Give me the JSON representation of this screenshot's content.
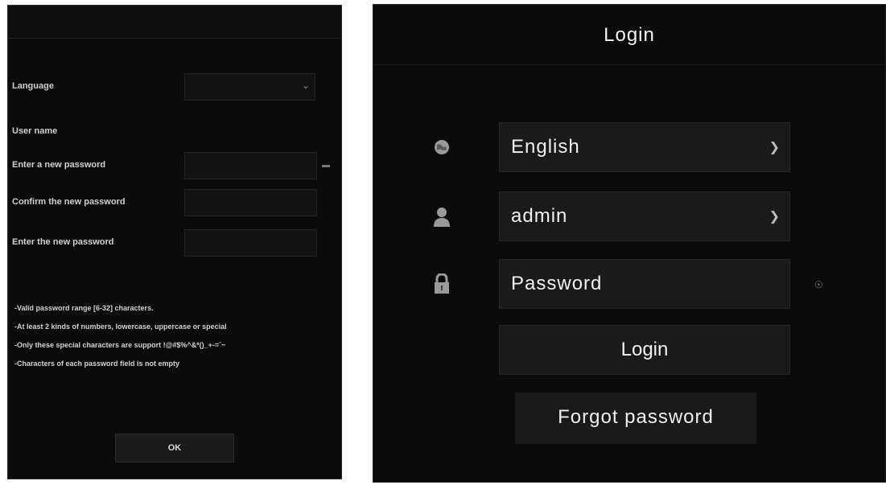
{
  "left_dialog": {
    "labels": {
      "language": "Language",
      "username": "User name",
      "new_password": "Enter a new password",
      "confirm_password": "Confirm the new password",
      "enter_password_again": "Enter the new password"
    },
    "rules": [
      "-Valid password range [6-32] characters.",
      "-At least 2 kinds of numbers, lowercase, uppercase or special",
      "-Only these special characters are support !@#$%^&*()_+-=`~",
      "-Characters of each password field is not empty"
    ],
    "ok_label": "OK"
  },
  "login_dialog": {
    "title": "Login",
    "language_value": "English",
    "username_value": "admin",
    "password_placeholder": "Password",
    "login_label": "Login",
    "forgot_label": "Forgot password"
  },
  "icons": {
    "globe": "globe-icon",
    "user": "user-icon",
    "lock": "lock-icon",
    "eye": "eye-icon",
    "chevron": "chevron-down-icon"
  },
  "colors": {
    "panel_bg": "#0b0b0b",
    "field_bg": "#1a1a1a",
    "text": "#f0f0f0"
  }
}
